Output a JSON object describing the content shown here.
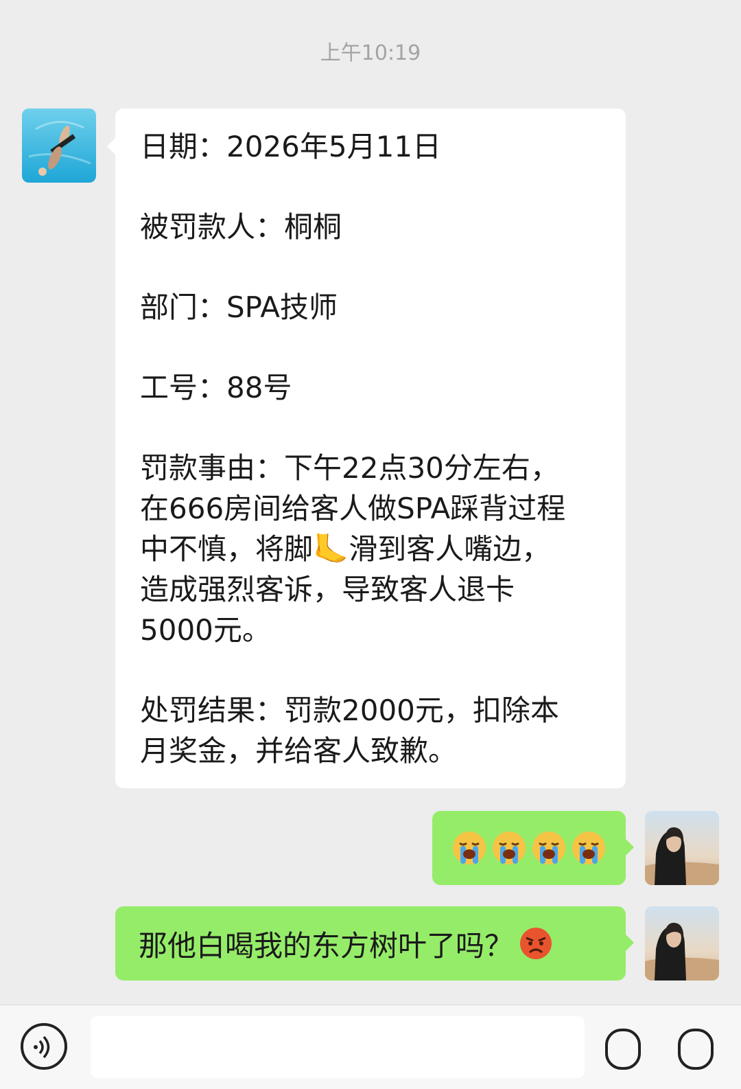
{
  "timestamp": "上午10:19",
  "incoming_message": {
    "lines": [
      "日期：2026年5月11日",
      "",
      "被罚款人：桐桐",
      "",
      "部门：SPA技师",
      "",
      "工号：88号",
      "",
      "罚款事由：下午22点30分左右，",
      "在666房间给客人做SPA踩背过程",
      "中不慎，将脚🦶滑到客人嘴边，",
      "造成强烈客诉，导致客人退卡",
      "5000元。",
      "",
      "处罚结果：罚款2000元，扣除本",
      "月奖金，并给客人致歉。"
    ]
  },
  "outgoing_messages": [
    {
      "emojis": [
        "loudly-crying-face",
        "loudly-crying-face",
        "loudly-crying-face",
        "loudly-crying-face"
      ]
    },
    {
      "text": "那他白喝我的东方树叶了吗？",
      "emoji": "pouting-face"
    }
  ],
  "colors": {
    "background": "#ededed",
    "incoming_bubble": "#ffffff",
    "outgoing_bubble": "#95ec69",
    "timestamp_text": "#a3a3a3"
  },
  "bottom_bar": {
    "icons": [
      "voice-icon",
      "emoji-icon",
      "plus-icon"
    ]
  }
}
